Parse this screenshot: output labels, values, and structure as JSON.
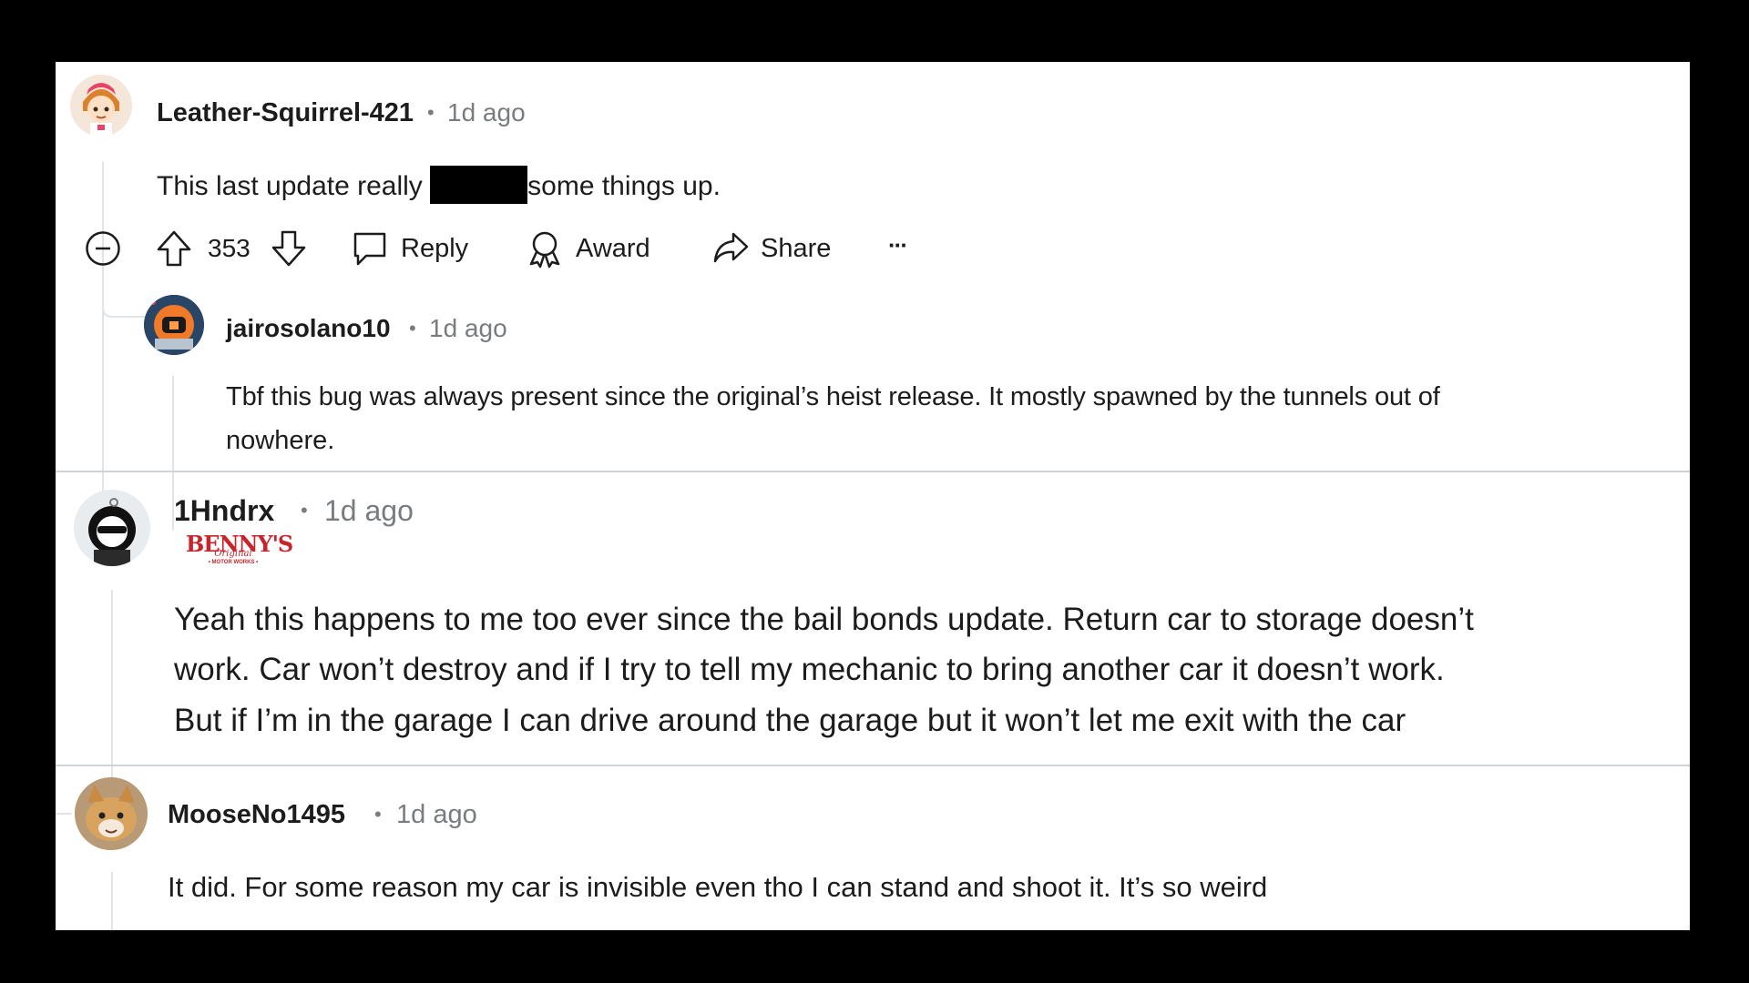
{
  "comments": [
    {
      "username": "Leather-Squirrel-421",
      "dot": "•",
      "time": "1d ago",
      "text_before": "This last update really",
      "text_after": "some things up.",
      "votes": "353",
      "actions": {
        "reply": "Reply",
        "award": "Award",
        "share": "Share",
        "more": "···"
      }
    },
    {
      "username": "jairosolano10",
      "dot": "•",
      "time": "1d ago",
      "lines": [
        "Tbf this bug was always present since the original’s heist release. It mostly spawned by the tunnels out of",
        "nowhere."
      ]
    },
    {
      "username": "1Hndrx",
      "dot": "•",
      "time": "1d ago",
      "flair": {
        "brand": "BENNY'S",
        "script": "Original",
        "sub": "• MOTOR WORKS •"
      },
      "lines": [
        "Yeah this happens to me too ever since the bail bonds update. Return car to storage doesn’t",
        "work. Car won’t destroy and if I try to tell my mechanic to bring another car it doesn’t work.",
        "But if I’m in the garage I can drive around the garage but it won’t let me exit with the car"
      ]
    },
    {
      "username": "MooseNo1495",
      "dot": "•",
      "time": "1d ago",
      "lines": [
        "It did. For some reason my car is invisible even tho I can stand and shoot it. It’s so weird"
      ]
    }
  ],
  "icons": {
    "collapse": "collapse-icon",
    "upvote": "upvote-icon",
    "downvote": "downvote-icon",
    "reply": "comment-bubble-icon",
    "award": "award-ribbon-icon",
    "share": "share-arrow-icon"
  },
  "colors": {
    "text": "#1c1c1c",
    "meta": "#787c7e",
    "flair_red": "#c8242b"
  }
}
